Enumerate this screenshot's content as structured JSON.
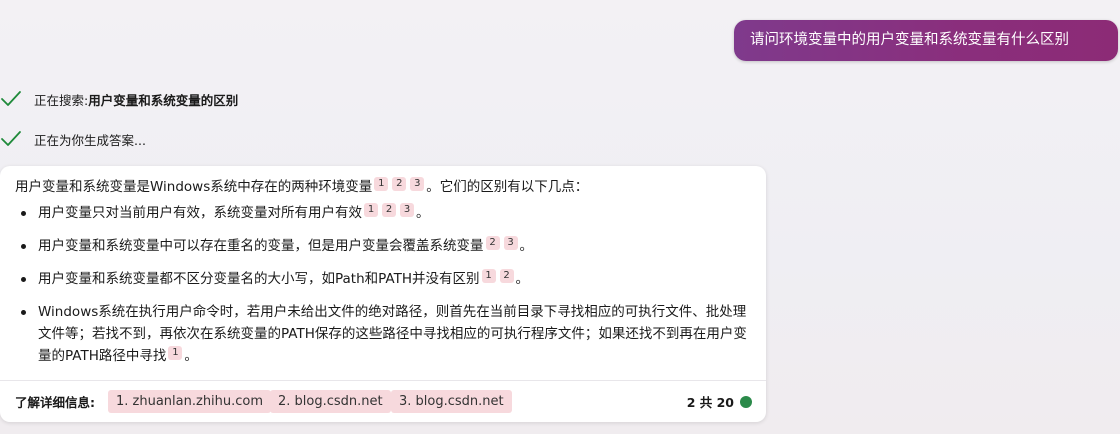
{
  "user_message": "请问环境变量中的用户变量和系统变量有什么区别",
  "status": {
    "searching_prefix": "正在搜索: ",
    "searching_query": "用户变量和系统变量的区别",
    "generating": "正在为你生成答案..."
  },
  "answer": {
    "lead_text": "用户变量和系统变量是Windows系统中存在的两种环境变量",
    "lead_refs": [
      "1",
      "2",
      "3"
    ],
    "lead_tail": "。它们的区别有以下几点：",
    "bullets": [
      {
        "text": "用户变量只对当前用户有效，系统变量对所有用户有效",
        "refs": [
          "1",
          "2",
          "3"
        ],
        "tail": "。"
      },
      {
        "text": "用户变量和系统变量中可以存在重名的变量，但是用户变量会覆盖系统变量",
        "refs": [
          "2",
          "3"
        ],
        "tail": "。"
      },
      {
        "text": "用户变量和系统变量都不区分变量名的大小写，如Path和PATH并没有区别",
        "refs": [
          "1",
          "2"
        ],
        "tail": "。"
      },
      {
        "text": "Windows系统在执行用户命令时，若用户未给出文件的绝对路径，则首先在当前目录下寻找相应的可执行文件、批处理文件等；若找不到，再依次在系统变量的PATH保存的这些路径中寻找相应的可执行程序文件；如果还找不到再在用户变量的PATH路径中寻找",
        "refs": [
          "1"
        ],
        "tail": "。"
      }
    ]
  },
  "learn_more": {
    "label": "了解详细信息:",
    "sources": [
      "1. zhuanlan.zhihu.com",
      "2. blog.csdn.net",
      "3. blog.csdn.net"
    ]
  },
  "counter": "2 共 20",
  "colors": {
    "user_bubble": "#8a2e7c",
    "check": "#1f8a3a",
    "ref_badge": "#f7d9dd",
    "status_dot": "#2b8a4a"
  }
}
